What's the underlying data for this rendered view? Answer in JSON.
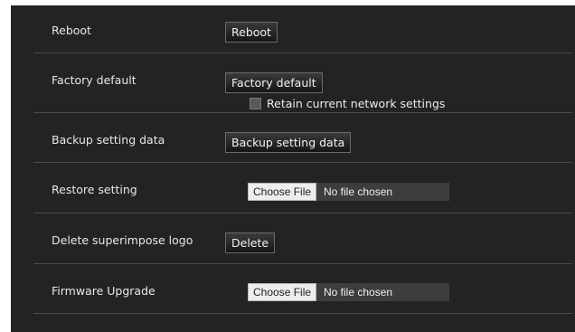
{
  "rows": [
    {
      "label": "Reboot",
      "button": "Reboot"
    },
    {
      "label": "Factory default",
      "button": "Factory default",
      "checkbox_label": "Retain current network settings",
      "checkbox_checked": false
    },
    {
      "label": "Backup setting data",
      "button": "Backup setting data"
    },
    {
      "label": "Restore setting",
      "file_button": "Choose File",
      "file_status": "No file chosen"
    },
    {
      "label": "Delete superimpose logo",
      "button": "Delete"
    },
    {
      "label": "Firmware Upgrade",
      "file_button": "Choose File",
      "file_status": "No file chosen"
    }
  ]
}
